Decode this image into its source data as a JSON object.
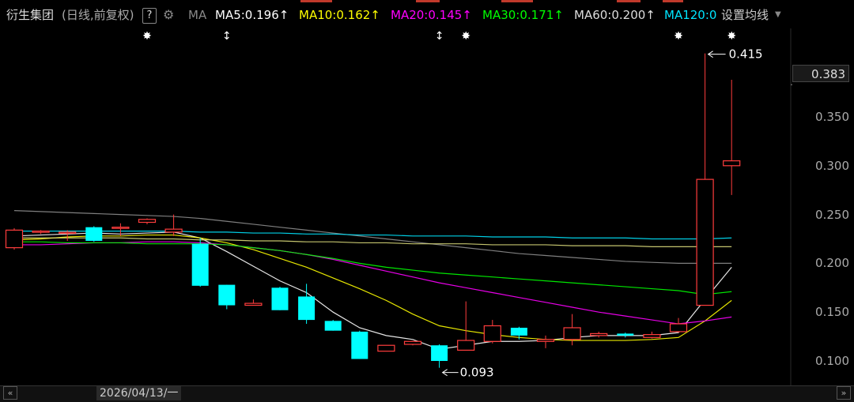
{
  "header": {
    "stock_name": "衍生集团",
    "mode": "(日线,前复权)",
    "help": "?",
    "ma_label": "MA",
    "ma5": "MA5:0.196",
    "ma10": "MA10:0.162",
    "ma20": "MA20:0.145",
    "ma30": "MA30:0.171",
    "ma60": "MA60:0.200",
    "ma120": "MA120:0",
    "settings": "设置均线",
    "up_arrow": "↑",
    "dropdown_icon": "chevron-down-icon",
    "gear_icon": "gear-icon"
  },
  "colors": {
    "ma5": "#ffffff",
    "ma10": "#ffff00",
    "ma20": "#ff00ff",
    "ma30": "#00ff00",
    "ma60": "#ffffff",
    "ma120": "#00e5ff",
    "up": "#ff3d3d",
    "down": "#00ffff",
    "mark": "#ffffff"
  },
  "price_axis": {
    "current": "0.383",
    "ticks": [
      "0.100",
      "0.150",
      "0.200",
      "0.250",
      "0.300",
      "0.350"
    ]
  },
  "annotations": {
    "high": "0.415",
    "low": "0.093"
  },
  "footer": {
    "date": "2026/04/13/一",
    "scroll_left": "«",
    "scroll_right": "»"
  },
  "chart_data": {
    "type": "candlestick",
    "ylim": [
      0.08,
      0.42
    ],
    "candles": [
      {
        "o": 0.216,
        "c": 0.234,
        "h": 0.236,
        "l": 0.214
      },
      {
        "o": 0.232,
        "c": 0.233,
        "h": 0.234,
        "l": 0.23
      },
      {
        "o": 0.231,
        "c": 0.232,
        "h": 0.234,
        "l": 0.223
      },
      {
        "o": 0.237,
        "c": 0.223,
        "h": 0.238,
        "l": 0.222
      },
      {
        "o": 0.236,
        "c": 0.237,
        "h": 0.241,
        "l": 0.228
      },
      {
        "o": 0.242,
        "c": 0.245,
        "h": 0.246,
        "l": 0.24
      },
      {
        "o": 0.232,
        "c": 0.235,
        "h": 0.25,
        "l": 0.228
      },
      {
        "o": 0.22,
        "c": 0.177,
        "h": 0.226,
        "l": 0.176
      },
      {
        "o": 0.178,
        "c": 0.157,
        "h": 0.178,
        "l": 0.153
      },
      {
        "o": 0.157,
        "c": 0.159,
        "h": 0.163,
        "l": 0.157
      },
      {
        "o": 0.175,
        "c": 0.152,
        "h": 0.176,
        "l": 0.152
      },
      {
        "o": 0.166,
        "c": 0.142,
        "h": 0.179,
        "l": 0.138
      },
      {
        "o": 0.141,
        "c": 0.131,
        "h": 0.142,
        "l": 0.131
      },
      {
        "o": 0.13,
        "c": 0.102,
        "h": 0.131,
        "l": 0.102
      },
      {
        "o": 0.11,
        "c": 0.116,
        "h": 0.116,
        "l": 0.11
      },
      {
        "o": 0.117,
        "c": 0.12,
        "h": 0.12,
        "l": 0.116
      },
      {
        "o": 0.116,
        "c": 0.1,
        "h": 0.117,
        "l": 0.093
      },
      {
        "o": 0.111,
        "c": 0.121,
        "h": 0.161,
        "l": 0.111
      },
      {
        "o": 0.12,
        "c": 0.136,
        "h": 0.142,
        "l": 0.118
      },
      {
        "o": 0.134,
        "c": 0.126,
        "h": 0.135,
        "l": 0.122
      },
      {
        "o": 0.12,
        "c": 0.122,
        "h": 0.126,
        "l": 0.113
      },
      {
        "o": 0.122,
        "c": 0.134,
        "h": 0.148,
        "l": 0.116
      },
      {
        "o": 0.126,
        "c": 0.128,
        "h": 0.13,
        "l": 0.124
      },
      {
        "o": 0.128,
        "c": 0.126,
        "h": 0.129,
        "l": 0.124
      },
      {
        "o": 0.124,
        "c": 0.127,
        "h": 0.13,
        "l": 0.123
      },
      {
        "o": 0.13,
        "c": 0.138,
        "h": 0.144,
        "l": 0.129
      },
      {
        "o": 0.157,
        "c": 0.286,
        "h": 0.415,
        "l": 0.157
      },
      {
        "o": 0.3,
        "c": 0.305,
        "h": 0.388,
        "l": 0.27
      }
    ],
    "series": [
      {
        "name": "MA5",
        "values": [
          0.228,
          0.229,
          0.23,
          0.231,
          0.23,
          0.231,
          0.232,
          0.226,
          0.212,
          0.197,
          0.182,
          0.17,
          0.15,
          0.134,
          0.126,
          0.122,
          0.112,
          0.116,
          0.12,
          0.12,
          0.121,
          0.124,
          0.126,
          0.126,
          0.126,
          0.129,
          0.163,
          0.196
        ]
      },
      {
        "name": "MA10",
        "values": [
          0.224,
          0.225,
          0.227,
          0.228,
          0.228,
          0.229,
          0.229,
          0.226,
          0.221,
          0.214,
          0.205,
          0.196,
          0.185,
          0.174,
          0.162,
          0.148,
          0.136,
          0.131,
          0.127,
          0.124,
          0.122,
          0.121,
          0.121,
          0.121,
          0.122,
          0.124,
          0.141,
          0.162
        ]
      },
      {
        "name": "MA20",
        "values": [
          0.219,
          0.219,
          0.22,
          0.221,
          0.221,
          0.222,
          0.222,
          0.221,
          0.219,
          0.216,
          0.213,
          0.209,
          0.204,
          0.198,
          0.192,
          0.186,
          0.18,
          0.175,
          0.17,
          0.165,
          0.16,
          0.155,
          0.15,
          0.146,
          0.142,
          0.138,
          0.141,
          0.145
        ]
      },
      {
        "name": "MA30",
        "values": [
          0.222,
          0.222,
          0.221,
          0.221,
          0.221,
          0.22,
          0.22,
          0.22,
          0.219,
          0.216,
          0.213,
          0.209,
          0.205,
          0.2,
          0.196,
          0.193,
          0.19,
          0.188,
          0.186,
          0.184,
          0.182,
          0.18,
          0.178,
          0.176,
          0.174,
          0.172,
          0.168,
          0.171
        ]
      },
      {
        "name": "MA60",
        "values": [
          0.254,
          0.253,
          0.252,
          0.251,
          0.25,
          0.249,
          0.248,
          0.246,
          0.243,
          0.24,
          0.237,
          0.234,
          0.231,
          0.228,
          0.225,
          0.222,
          0.219,
          0.216,
          0.213,
          0.21,
          0.208,
          0.206,
          0.204,
          0.202,
          0.201,
          0.2,
          0.2,
          0.2
        ]
      },
      {
        "name": "MA120",
        "values": [
          0.233,
          0.233,
          0.233,
          0.233,
          0.233,
          0.233,
          0.233,
          0.232,
          0.232,
          0.231,
          0.231,
          0.23,
          0.23,
          0.229,
          0.229,
          0.228,
          0.228,
          0.228,
          0.227,
          0.227,
          0.227,
          0.226,
          0.226,
          0.226,
          0.225,
          0.225,
          0.225,
          0.226
        ]
      },
      {
        "name": "MA(extra)",
        "values": [
          0.226,
          0.226,
          0.226,
          0.226,
          0.226,
          0.225,
          0.225,
          0.224,
          0.224,
          0.223,
          0.223,
          0.222,
          0.222,
          0.221,
          0.221,
          0.22,
          0.22,
          0.22,
          0.219,
          0.219,
          0.219,
          0.218,
          0.218,
          0.218,
          0.217,
          0.217,
          0.217,
          0.217
        ]
      }
    ],
    "marks_top": [
      {
        "index": 5,
        "glyph": "✸"
      },
      {
        "index": 8,
        "glyph": "↕"
      },
      {
        "index": 16,
        "glyph": "↕"
      },
      {
        "index": 17,
        "glyph": "✸"
      },
      {
        "index": 25,
        "glyph": "✸"
      },
      {
        "index": 27,
        "glyph": "✸"
      }
    ]
  }
}
